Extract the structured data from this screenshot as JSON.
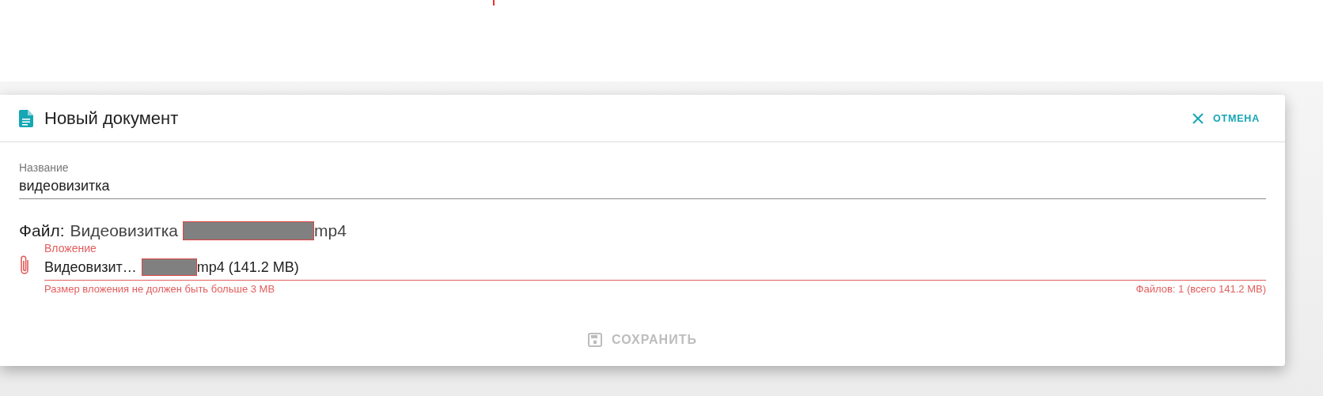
{
  "dialog": {
    "title": "Новый документ",
    "cancel_button": "ОТМЕНА",
    "name_field": {
      "label": "Название",
      "value": "видеовизитка"
    },
    "file_line": {
      "label": "Файл:",
      "prefix": "Видеовизитка",
      "suffix": "mp4"
    },
    "attachment": {
      "label": "Вложение",
      "prefix": "Видеовизит…",
      "suffix": "mp4 (141.2 MB)",
      "error": true,
      "error_text": "Размер вложения не должен быть больше 3 MB",
      "count_text": "Файлов: 1 (всего 141.2 MB)"
    },
    "save_button": {
      "label": "СОХРАНИТЬ",
      "disabled": true
    }
  }
}
